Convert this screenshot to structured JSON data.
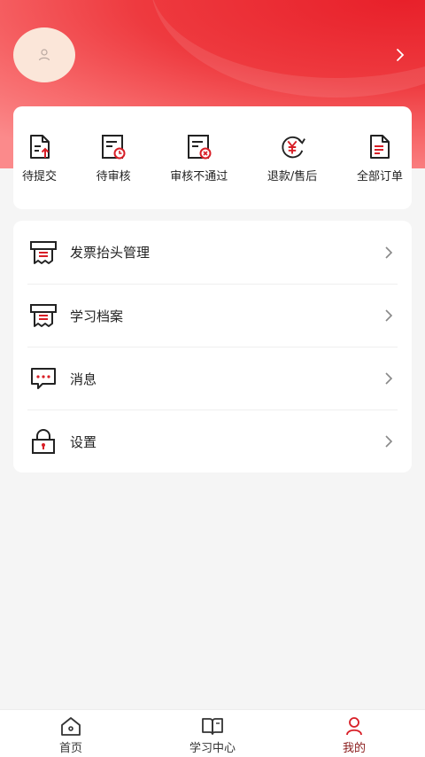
{
  "orders": [
    {
      "id": "pending-submit",
      "label": "待提交",
      "icon": "document-upload-icon"
    },
    {
      "id": "pending-review",
      "label": "待审核",
      "icon": "document-clock-icon"
    },
    {
      "id": "review-failed",
      "label": "审核不通过",
      "icon": "document-reject-icon"
    },
    {
      "id": "refund",
      "label": "退款/售后",
      "icon": "yuan-refund-icon"
    },
    {
      "id": "all-orders",
      "label": "全部订单",
      "icon": "document-list-icon"
    }
  ],
  "menu": [
    {
      "id": "invoice-title",
      "label": "发票抬头管理",
      "icon": "invoice-icon"
    },
    {
      "id": "study-archive",
      "label": "学习档案",
      "icon": "archive-icon"
    },
    {
      "id": "messages",
      "label": "消息",
      "icon": "chat-bubble-icon"
    },
    {
      "id": "settings",
      "label": "设置",
      "icon": "lock-icon"
    }
  ],
  "tabs": [
    {
      "id": "home",
      "label": "首页",
      "icon": "home-icon",
      "active": false
    },
    {
      "id": "study",
      "label": "学习中心",
      "icon": "book-icon",
      "active": false
    },
    {
      "id": "mine",
      "label": "我的",
      "icon": "user-icon",
      "active": true
    }
  ],
  "colors": {
    "accent": "#d81e26",
    "active_tab": "#8a1b1b",
    "header": "#ee3a3f"
  }
}
